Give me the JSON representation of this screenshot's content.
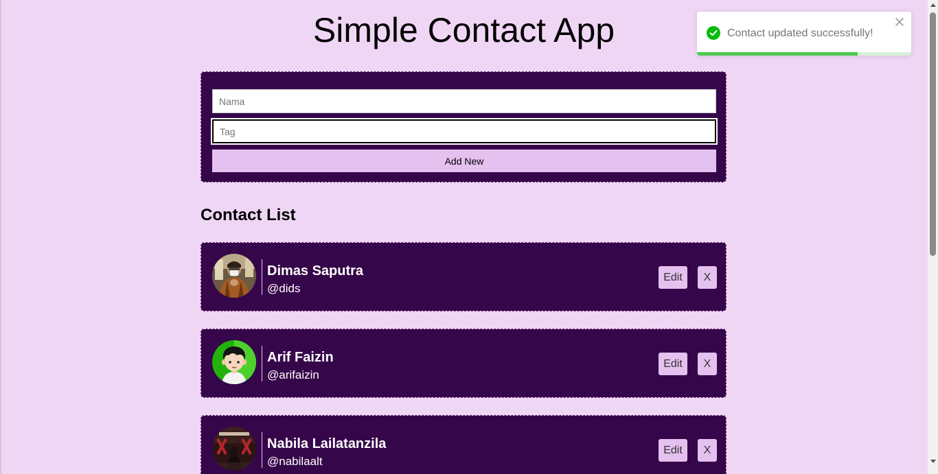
{
  "app": {
    "title": "Simple Contact App"
  },
  "form": {
    "name_placeholder": "Nama",
    "name_value": "",
    "tag_placeholder": "Tag",
    "tag_value": "",
    "add_label": "Add New"
  },
  "contact_list": {
    "title": "Contact List",
    "contacts": [
      {
        "name": "Dimas Saputra",
        "tag": "@dids",
        "avatar": "photo-person-glasses",
        "edit_label": "Edit",
        "delete_label": "X"
      },
      {
        "name": "Arif Faizin",
        "tag": "@arifaizin",
        "avatar": "cartoon-boy-green",
        "edit_label": "Edit",
        "delete_label": "X"
      },
      {
        "name": "Nabila Lailatanzila",
        "tag": "@nabilaalt",
        "avatar": "photo-it-fair-xiii",
        "edit_label": "Edit",
        "delete_label": "X"
      }
    ]
  },
  "toast": {
    "message": "Contact updated successfully!",
    "status": "success",
    "icon": "check-circle-icon",
    "close_icon": "close-icon",
    "progress_remaining": 0.75,
    "colors": {
      "success": "#07bc0c",
      "progress": "#4bc94f"
    }
  },
  "colors": {
    "page_background": "#f0d6f5",
    "card_background": "#36064a",
    "button_background": "#e4c1ef"
  }
}
